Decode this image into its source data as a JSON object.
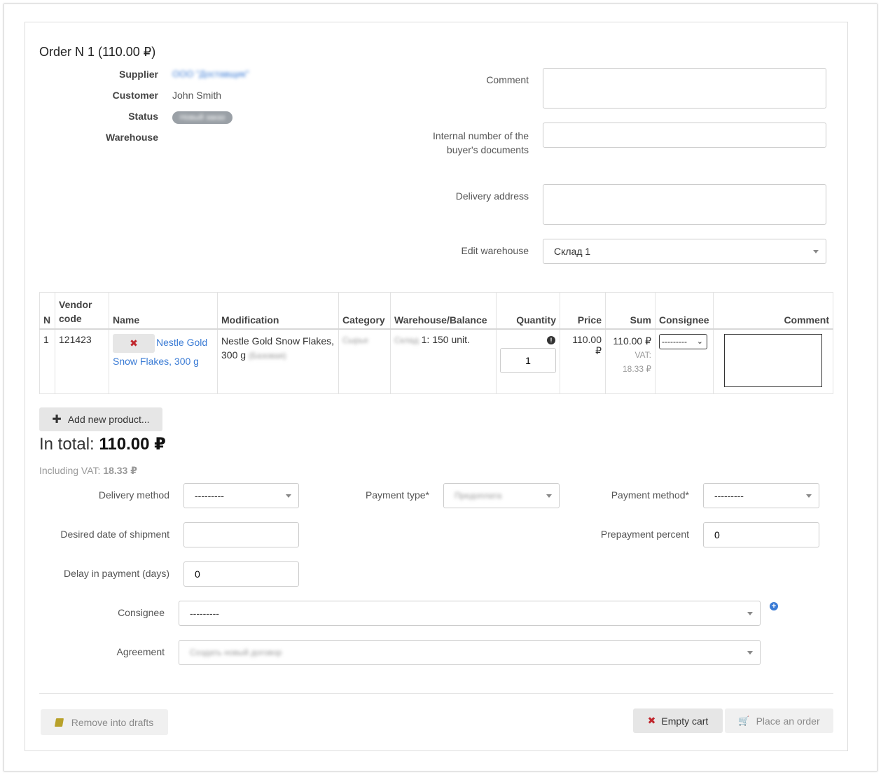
{
  "order": {
    "title": "Order N 1 (110.00 ₽)",
    "supplier_label": "Supplier",
    "supplier_value": "ООО \"Доставщик\"",
    "customer_label": "Customer",
    "customer_value": "John Smith",
    "status_label": "Status",
    "status_value": "Новый заказ",
    "warehouse_label": "Warehouse"
  },
  "form_right": {
    "comment_label": "Comment",
    "comment_value": "",
    "internal_label": "Internal number of the buyer's documents",
    "internal_value": "",
    "delivery_address_label": "Delivery address",
    "delivery_address_value": "",
    "edit_warehouse_label": "Edit warehouse",
    "edit_warehouse_value": "Склад 1"
  },
  "table": {
    "headers": {
      "n": "N",
      "vendor_code": "Vendor code",
      "name": "Name",
      "modification": "Modification",
      "category": "Category",
      "warehouse_balance": "Warehouse/Balance",
      "quantity": "Quantity",
      "price": "Price",
      "sum": "Sum",
      "consignee": "Consignee",
      "comment": "Comment"
    },
    "rows": [
      {
        "n": "1",
        "vendor_code": "121423",
        "name": "Nestle Gold Snow Flakes, 300 g",
        "modification": "Nestle Gold Snow Flakes, 300 g",
        "modification_extra": "(Базовая)",
        "category": "Сырье",
        "warehouse": "Склад",
        "balance": "1: 150 unit.",
        "quantity": "1",
        "price": "110.00 ₽",
        "sum": "110.00 ₽",
        "vat_label": "VAT:",
        "vat_value": "18.33 ₽",
        "consignee": "---------",
        "comment": ""
      }
    ]
  },
  "add_product_label": "Add new product...",
  "total": {
    "label": "In total:",
    "value": "110.00 ₽",
    "vat_label": "Including VAT:",
    "vat_value": "18.33 ₽"
  },
  "bottom_form": {
    "delivery_method_label": "Delivery method",
    "delivery_method_value": "---------",
    "payment_type_label": "Payment type*",
    "payment_type_value": "Предоплата",
    "payment_method_label": "Payment method*",
    "payment_method_value": "---------",
    "desired_date_label": "Desired date of shipment",
    "desired_date_value": "",
    "prepayment_percent_label": "Prepayment percent",
    "prepayment_percent_value": "0",
    "delay_label": "Delay in payment (days)",
    "delay_value": "0",
    "consignee_label": "Consignee",
    "consignee_value": "---------",
    "agreement_label": "Agreement",
    "agreement_value": "Создать новый договор"
  },
  "buttons": {
    "drafts": "Remove into drafts",
    "empty_cart": "Empty cart",
    "place_order": "Place an order"
  },
  "colors": {
    "link": "#3a7bd5",
    "danger": "#c0262d",
    "badge": "#9aa0a6"
  }
}
